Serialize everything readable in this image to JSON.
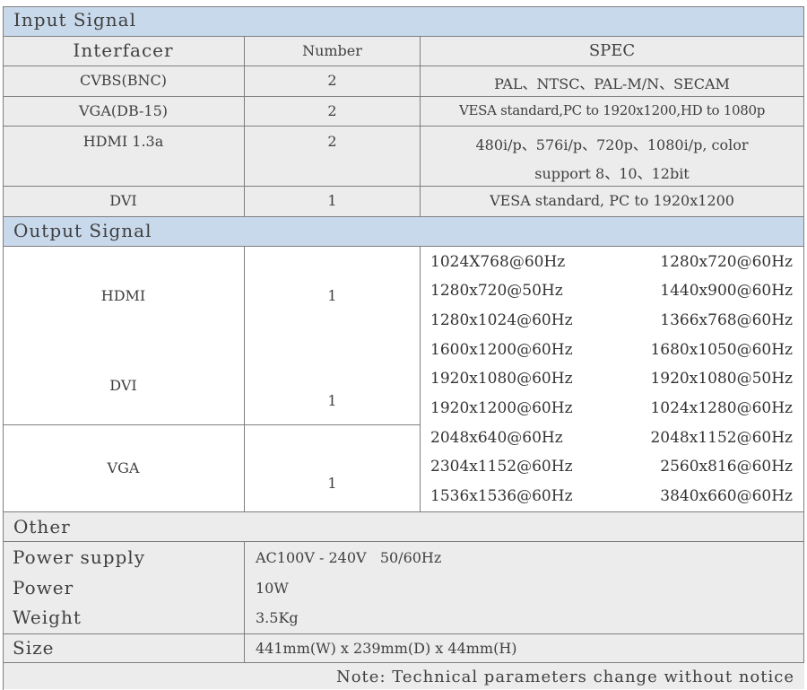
{
  "input_section": {
    "title": "Input Signal",
    "headers": [
      "Interfacer",
      "Number",
      "SPEC"
    ],
    "rows": [
      {
        "interface": "CVBS(BNC)",
        "number": "2",
        "spec": "PAL、NTSC、PAL-M/N、SECAM"
      },
      {
        "interface": "VGA(DB-15)",
        "number": "2",
        "spec": "VESA standard,PC to 1920x1200,HD to 1080p"
      },
      {
        "interface": "HDMI 1.3a",
        "number": "2",
        "spec_line1": "480i/p、576i/p、720p、1080i/p, color",
        "spec_line2": "support 8、10、12bit"
      },
      {
        "interface": "DVI",
        "number": "1",
        "spec": "VESA standard, PC to 1920x1200"
      }
    ]
  },
  "output_section": {
    "title": "Output Signal",
    "interfaces": [
      {
        "name": "HDMI",
        "number": "1"
      },
      {
        "name": "DVI",
        "number": "1"
      },
      {
        "name": "VGA",
        "number": "1"
      }
    ],
    "modes": [
      [
        "1024X768@60Hz",
        "1280x720@60Hz"
      ],
      [
        "1280x720@50Hz",
        "1440x900@60Hz"
      ],
      [
        "1280x1024@60Hz",
        "1366x768@60Hz"
      ],
      [
        "1600x1200@60Hz",
        "1680x1050@60Hz"
      ],
      [
        "1920x1080@60Hz",
        "1920x1080@50Hz"
      ],
      [
        "1920x1200@60Hz",
        "1024x1280@60Hz"
      ],
      [
        "2048x640@60Hz",
        "2048x1152@60Hz"
      ],
      [
        "2304x1152@60Hz",
        "2560x816@60Hz"
      ],
      [
        "1536x1536@60Hz",
        "3840x660@60Hz"
      ]
    ]
  },
  "other_section": {
    "title": "Other",
    "power_supply_label": "Power supply",
    "power_supply_value": "AC100V - 240V   50/60Hz",
    "power_label": "Power",
    "power_value": "10W",
    "weight_label": "Weight",
    "weight_value": "3.5Kg",
    "size_label": "Size",
    "size_value": "441mm(W) x 239mm(D) x 44mm(H)",
    "note": "Note: Technical parameters change without notice"
  },
  "colors": {
    "section_band": "#c9d9ec",
    "row_fill": "#ececec",
    "grid_line": "#7f7f7f"
  }
}
